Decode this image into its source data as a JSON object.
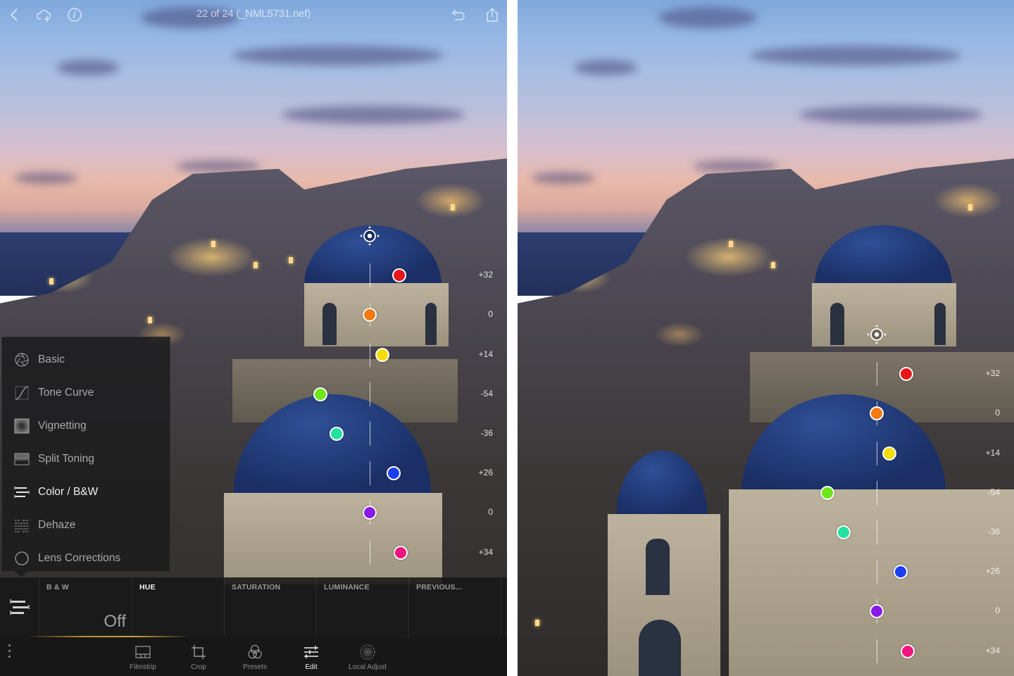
{
  "topbar": {
    "title": "22 of 24 (_NML5731.nef)",
    "icons": [
      "back-chevron-icon",
      "cloud-add-icon",
      "info-icon",
      "undo-icon",
      "share-icon"
    ]
  },
  "edit_menu": {
    "items": [
      {
        "label": "Basic",
        "icon": "aperture-icon",
        "active": false
      },
      {
        "label": "Tone Curve",
        "icon": "tone-curve-icon",
        "active": false
      },
      {
        "label": "Vignetting",
        "icon": "vignette-icon",
        "active": false
      },
      {
        "label": "Split Toning",
        "icon": "split-toning-icon",
        "active": false
      },
      {
        "label": "Color / B&W",
        "icon": "color-bw-icon",
        "active": true
      },
      {
        "label": "Dehaze",
        "icon": "dehaze-icon",
        "active": false
      },
      {
        "label": "Lens Corrections",
        "icon": "lens-icon",
        "active": false
      }
    ]
  },
  "subpanel": {
    "tabs": [
      {
        "label": "B & W",
        "value": "Off",
        "active": false
      },
      {
        "label": "HUE",
        "value": "",
        "active": true
      },
      {
        "label": "SATURATION",
        "value": "",
        "active": false
      },
      {
        "label": "LUMINANCE",
        "value": "",
        "active": false
      },
      {
        "label": "PREVIOUS...",
        "value": "",
        "active": false
      }
    ]
  },
  "toolbar": {
    "items": [
      {
        "label": "Filmstrip",
        "icon": "filmstrip-icon",
        "active": false
      },
      {
        "label": "Crop",
        "icon": "crop-icon",
        "active": false
      },
      {
        "label": "Presets",
        "icon": "presets-icon",
        "active": false
      },
      {
        "label": "Edit",
        "icon": "edit-sliders-icon",
        "active": true
      },
      {
        "label": "Local Adjust",
        "icon": "local-adjust-icon",
        "active": false
      }
    ]
  },
  "hue_adjustments": {
    "channels": [
      {
        "name": "red",
        "color": "#e8161c",
        "value": "+32"
      },
      {
        "name": "orange",
        "color": "#f47a12",
        "value": "0"
      },
      {
        "name": "yellow",
        "color": "#f5dc0a",
        "value": "+14"
      },
      {
        "name": "green",
        "color": "#6ee61a",
        "value": "-54"
      },
      {
        "name": "aqua",
        "color": "#22e0a0",
        "value": "-36"
      },
      {
        "name": "blue",
        "color": "#1a3ef0",
        "value": "+26"
      },
      {
        "name": "purple",
        "color": "#8a1ae8",
        "value": "0"
      },
      {
        "name": "magenta",
        "color": "#f0147c",
        "value": "+34"
      }
    ]
  }
}
